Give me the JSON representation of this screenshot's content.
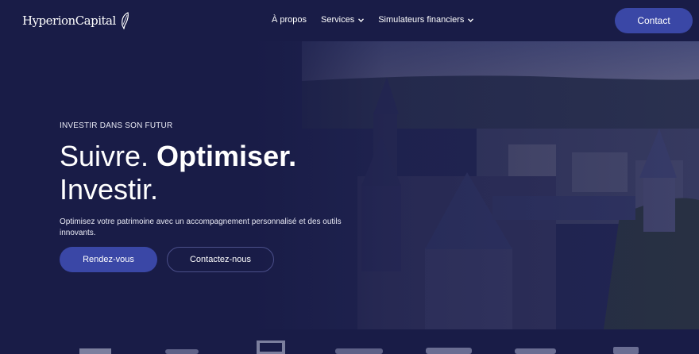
{
  "brand": {
    "name": "HyperionCapital"
  },
  "nav": {
    "links": [
      {
        "label": "À propos",
        "has_dropdown": false
      },
      {
        "label": "Services",
        "has_dropdown": true
      },
      {
        "label": "Simulateurs financiers",
        "has_dropdown": true
      }
    ],
    "cta_label": "Contact"
  },
  "hero": {
    "eyebrow": "INVESTIR DANS SON FUTUR",
    "headline_part1": "Suivre. ",
    "headline_bold": "Optimiser.",
    "headline_part2": "Investir.",
    "subtext": "Optimisez votre patrimoine avec un accompagnement personnalisé et des outils innovants.",
    "primary_button": "Rendez-vous",
    "secondary_button": "Contactez-nous"
  },
  "press_logos": [
    {
      "name": "BMB-logo"
    },
    {
      "name": "le-point-logo"
    },
    {
      "name": "bfm-logo"
    },
    {
      "name": "challenges-logo"
    },
    {
      "name": "le-monde-logo"
    },
    {
      "name": "les-echos-logo"
    },
    {
      "name": "jdn-logo"
    }
  ],
  "colors": {
    "navy": "#191c47",
    "accent": "#3a47a6"
  }
}
